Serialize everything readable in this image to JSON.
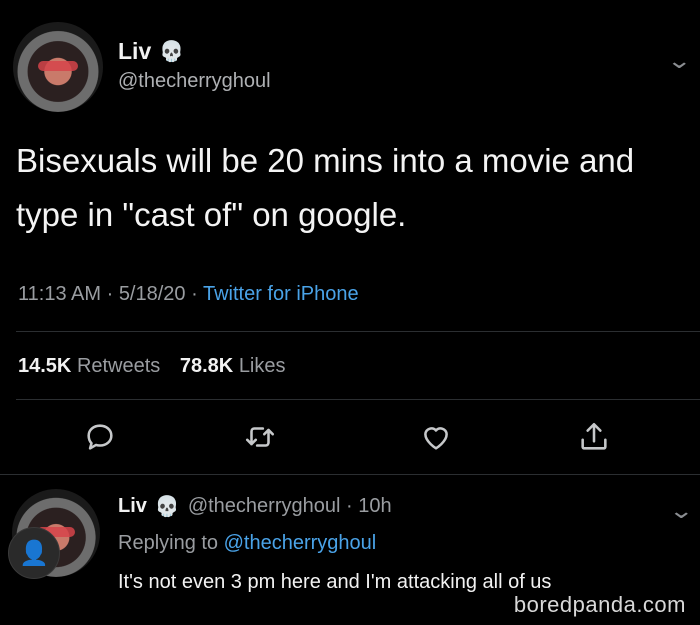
{
  "main_tweet": {
    "display_name": "Liv",
    "name_emoji": "💀",
    "handle": "@thecherryghoul",
    "text_line1": "Bisexuals will be 20 mins into a movie and",
    "text_line2": "type in \"cast of\" on google.",
    "time": "11:13 AM",
    "sep1": " · ",
    "date": "5/18/20",
    "sep2": " · ",
    "source": "Twitter for iPhone",
    "retweets_count": "14.5K",
    "retweets_label": "Retweets",
    "likes_count": "78.8K",
    "likes_label": "Likes",
    "actions": [
      "reply-icon",
      "retweet-icon",
      "like-icon",
      "share-icon"
    ]
  },
  "reply_tweet": {
    "display_name": "Liv",
    "name_emoji": "💀",
    "handle_time": "@thecherryghoul · 10h",
    "replying_prefix": "Replying to ",
    "replying_to": "@thecherryghoul",
    "text": "It's not even 3 pm here and I'm attacking all of us"
  },
  "watermark": "boredpanda.com",
  "colors": {
    "background": "#000000",
    "link": "#4aa3e8",
    "muted": "#9a9da1",
    "divider": "#2b2e31"
  }
}
